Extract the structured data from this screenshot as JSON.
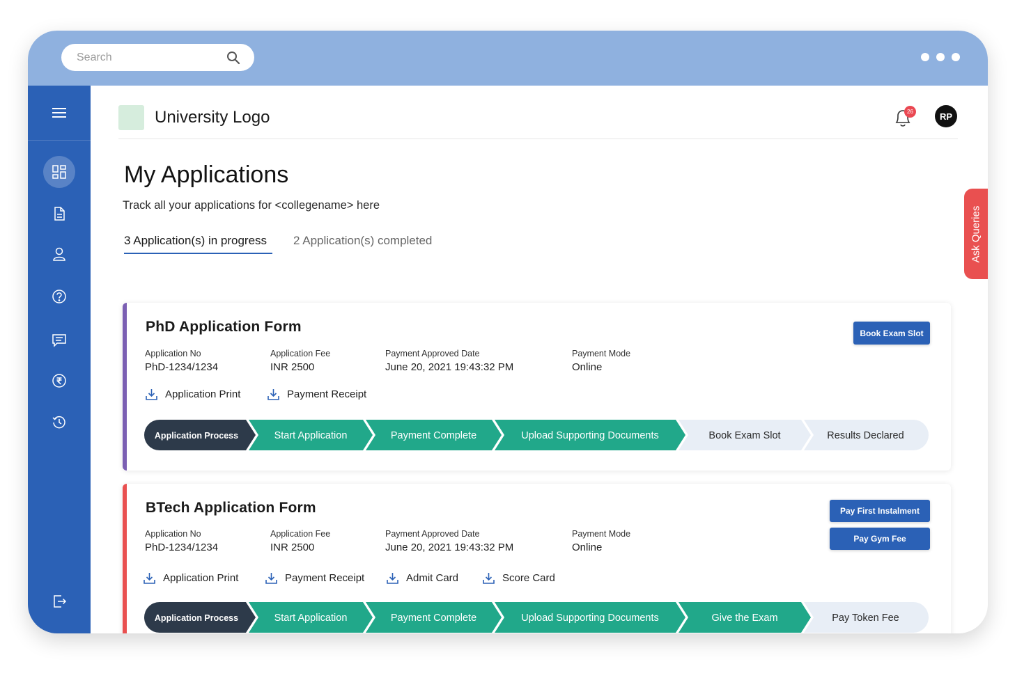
{
  "topbar": {
    "search_placeholder": "Search",
    "icons": [
      "search-icon",
      "more-dots-icon"
    ]
  },
  "sidebar": {
    "items": [
      "menu-icon",
      "dashboard-icon",
      "document-icon",
      "user-icon",
      "help-icon",
      "chat-icon",
      "rupee-icon",
      "history-icon",
      "logout-icon"
    ],
    "active": "dashboard-icon"
  },
  "header": {
    "logo_text": "University Logo",
    "notification_count": "26",
    "avatar_initials": "RP"
  },
  "page": {
    "title": "My Applications",
    "subtitle": "Track all your applications for <collegename> here"
  },
  "tabs": [
    {
      "label": "3 Application(s) in progress",
      "active": true
    },
    {
      "label": "2 Application(s) completed",
      "active": false
    }
  ],
  "ask_queries": "Ask Queries",
  "colors": {
    "primary": "#2b61b6",
    "topbar": "#8fb1df",
    "step_done": "#21a88a",
    "step_current": "#2d3a4a",
    "step_pending": "#e8eef6",
    "accent_red": "#e95050",
    "accent_purple": "#7b5fb3"
  },
  "applications": [
    {
      "title": "PhD Application Form",
      "fields": [
        {
          "label": "Application No",
          "value": "PhD-1234/1234"
        },
        {
          "label": "Application Fee",
          "value": "INR 2500"
        },
        {
          "label": "Payment Approved Date",
          "value": "June 20, 2021 19:43:32 PM"
        },
        {
          "label": "Payment Mode",
          "value": "Online"
        }
      ],
      "links": [
        "Application Print",
        "Payment Receipt"
      ],
      "buttons": [
        "Book Exam Slot"
      ],
      "steps": [
        {
          "label": "Application Process",
          "status": "current"
        },
        {
          "label": "Start Application",
          "status": "done"
        },
        {
          "label": "Payment Complete",
          "status": "done"
        },
        {
          "label": "Upload Supporting Documents",
          "status": "done"
        },
        {
          "label": "Book Exam Slot",
          "status": "pending"
        },
        {
          "label": "Results Declared",
          "status": "pending"
        }
      ]
    },
    {
      "title": "BTech Application Form",
      "fields": [
        {
          "label": "Application No",
          "value": "PhD-1234/1234"
        },
        {
          "label": "Application Fee",
          "value": "INR 2500"
        },
        {
          "label": "Payment Approved Date",
          "value": "June 20, 2021 19:43:32 PM"
        },
        {
          "label": "Payment Mode",
          "value": "Online"
        }
      ],
      "links": [
        "Application Print",
        "Payment Receipt",
        "Admit Card",
        "Score Card"
      ],
      "buttons": [
        "Pay First Instalment",
        "Pay Gym Fee"
      ],
      "steps": [
        {
          "label": "Application Process",
          "status": "current"
        },
        {
          "label": "Start Application",
          "status": "done"
        },
        {
          "label": "Payment Complete",
          "status": "done"
        },
        {
          "label": "Upload Supporting Documents",
          "status": "done"
        },
        {
          "label": "Give the Exam",
          "status": "done"
        },
        {
          "label": "Pay Token Fee",
          "status": "pending"
        }
      ]
    }
  ]
}
